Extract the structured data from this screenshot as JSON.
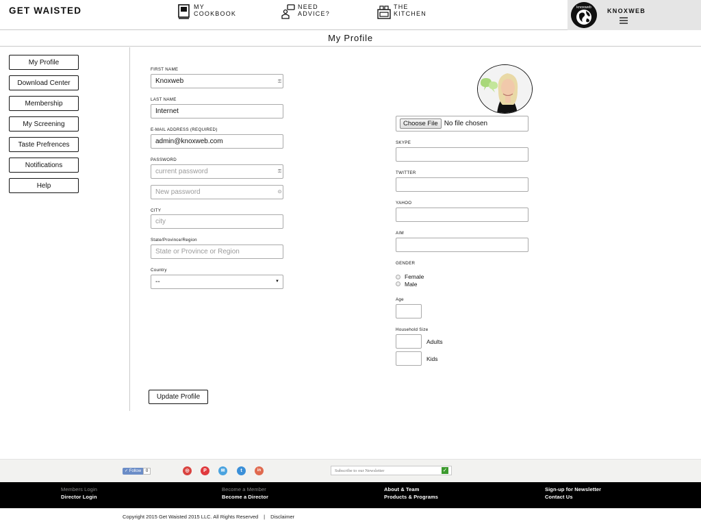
{
  "header": {
    "brand": "GET WAISTED",
    "nav": [
      {
        "line1": "MY",
        "line2": "COOKBOOK",
        "icon": "cookbook-icon"
      },
      {
        "line1": "NEED",
        "line2": "ADVICE?",
        "icon": "advice-icon"
      },
      {
        "line1": "THE",
        "line2": "KITCHEN",
        "icon": "kitchen-icon"
      }
    ],
    "user": {
      "name": "KNOXWEB",
      "avatar_text": "knoxweb"
    }
  },
  "page_title": "My Profile",
  "sidebar": {
    "items": [
      {
        "label": "My Profile"
      },
      {
        "label": "Download Center"
      },
      {
        "label": "Membership"
      },
      {
        "label": "My Screening"
      },
      {
        "label": "Taste Prefrences"
      },
      {
        "label": "Notifications"
      },
      {
        "label": "Help"
      }
    ]
  },
  "form": {
    "first_name": {
      "label": "FIRST NAME",
      "value": "Knoxweb"
    },
    "last_name": {
      "label": "LAST NAME",
      "value": "Internet"
    },
    "email": {
      "label": "E-MAIL ADDRESS (REQUIRED)",
      "value": "admin@knoxweb.com"
    },
    "password": {
      "label": "PASSWORD",
      "current_placeholder": "current password",
      "new_placeholder": "New password"
    },
    "city": {
      "label": "CITY",
      "placeholder": "city"
    },
    "state": {
      "label": "State/Province/Region",
      "placeholder": "State or Province or Region"
    },
    "country": {
      "label": "Country",
      "value": "--"
    },
    "file": {
      "button": "Choose File",
      "status": "No file chosen"
    },
    "skype": {
      "label": "SKYPE"
    },
    "twitter": {
      "label": "TWITTER"
    },
    "yahoo": {
      "label": "YAHOO"
    },
    "aim": {
      "label": "AIM"
    },
    "gender": {
      "label": "GENDER",
      "options": [
        "Female",
        "Male"
      ]
    },
    "age": {
      "label": "Age"
    },
    "household": {
      "label": "Household Size",
      "adults": "Adults",
      "kids": "Kids"
    },
    "submit": "Update Profile"
  },
  "footer": {
    "follow": {
      "label": "Follow",
      "count": "0"
    },
    "social": [
      {
        "name": "instagram-icon",
        "color": "#d9433f",
        "glyph": "◎"
      },
      {
        "name": "pinterest-icon",
        "color": "#e03a3e",
        "glyph": "P"
      },
      {
        "name": "email-icon",
        "color": "#4aa3df",
        "glyph": "✉"
      },
      {
        "name": "twitter-icon",
        "color": "#3a8fd8",
        "glyph": "t"
      },
      {
        "name": "linkedin-icon",
        "color": "#e06a4f",
        "glyph": "in"
      }
    ],
    "newsletter_placeholder": "Subscribe to our Newsletter",
    "links": {
      "members_login": "Members Login",
      "director_login": "Director Login",
      "become_member": "Become a Member",
      "become_director": "Become a Director",
      "about_team": "About & Team",
      "products_programs": "Products & Programs",
      "signup_newsletter": "Sign-up for Newsletter",
      "contact_us": "Contact Us"
    },
    "copyright": "Copyright 2015 Get Waisted 2015 LLC. All Rights Reserved",
    "separator": "|",
    "disclaimer": "Disclaimer"
  }
}
